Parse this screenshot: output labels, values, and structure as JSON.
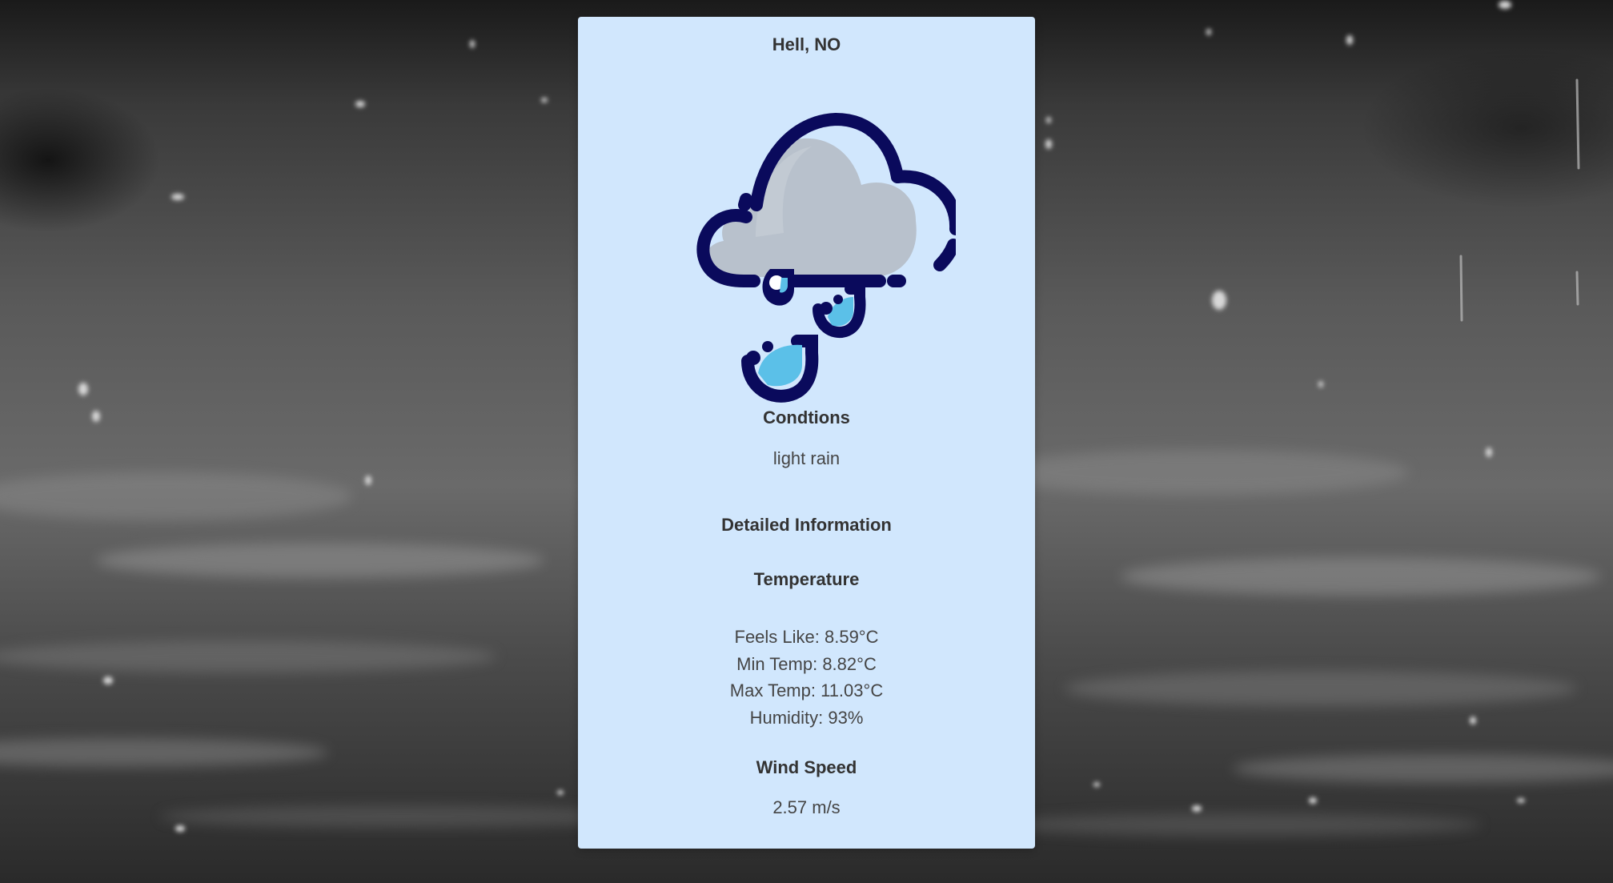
{
  "location": "Hell, NO",
  "weather_icon": "light-rain-cloud-icon",
  "conditions": {
    "heading": "Condtions",
    "value": "light rain"
  },
  "details": {
    "heading": "Detailed Information",
    "temperature": {
      "heading": "Temperature",
      "feels_like": "Feels Like: 8.59°C",
      "min_temp": "Min Temp: 8.82°C",
      "max_temp": "Max Temp: 11.03°C",
      "humidity": "Humidity: 93%"
    },
    "wind": {
      "heading": "Wind Speed",
      "value": "2.57 m/s"
    }
  },
  "colors": {
    "card_background": "#d1e7fd",
    "icon_outline": "#0a0a5c",
    "icon_cloud": "#b8c1cc",
    "icon_drop": "#5bc0e8"
  }
}
